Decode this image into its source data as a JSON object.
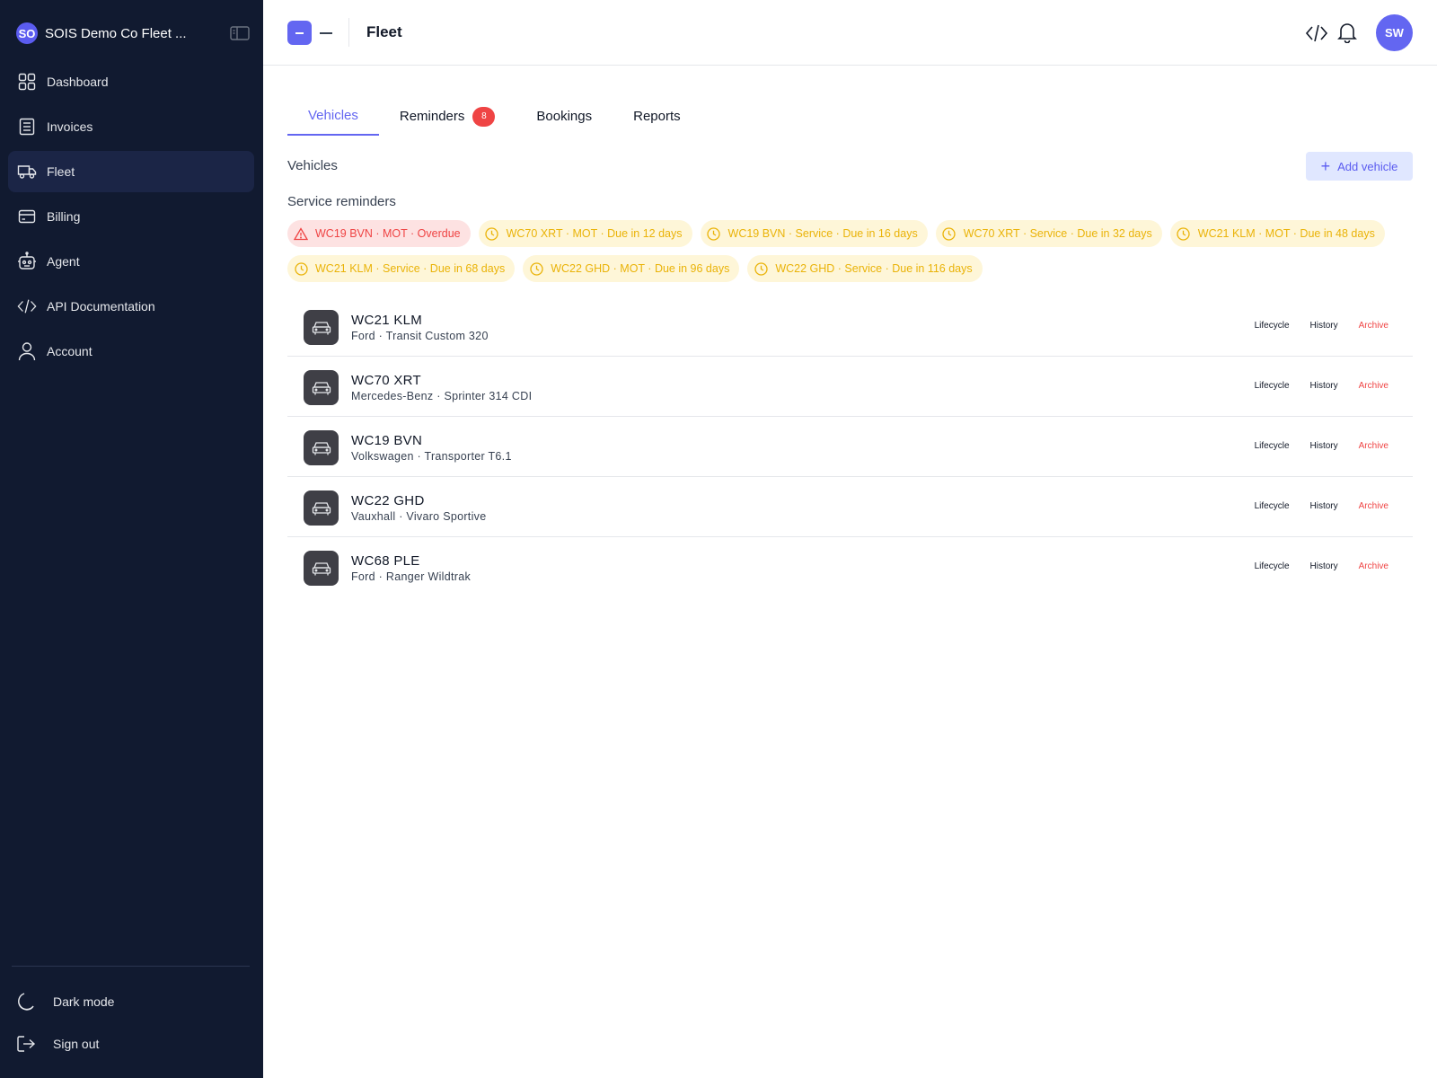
{
  "sidebar": {
    "org_badge": "SO",
    "org_name": "SOIS Demo Co Fleet ...",
    "nav": [
      {
        "label": "Dashboard",
        "icon": "grid-icon"
      },
      {
        "label": "Invoices",
        "icon": "document-icon"
      },
      {
        "label": "Fleet",
        "icon": "truck-icon",
        "active": true
      },
      {
        "label": "Billing",
        "icon": "credit-card-icon"
      },
      {
        "label": "Agent",
        "icon": "robot-icon"
      },
      {
        "label": "API Documentation",
        "icon": "code-icon"
      },
      {
        "label": "Account",
        "icon": "user-icon"
      }
    ],
    "dark_mode_label": "Dark mode",
    "sign_out_label": "Sign out"
  },
  "topbar": {
    "title": "Fleet",
    "avatar_initials": "SW"
  },
  "tabs": [
    {
      "label": "Vehicles",
      "active": true
    },
    {
      "label": "Reminders",
      "badge": "8"
    },
    {
      "label": "Bookings"
    },
    {
      "label": "Reports"
    }
  ],
  "main": {
    "vehicles_heading": "Vehicles",
    "add_vehicle_label": "Add vehicle",
    "reminders_heading": "Service reminders"
  },
  "reminders": [
    {
      "text": "WC19 BVN · MOT · Overdue",
      "status": "overdue"
    },
    {
      "text": "WC70 XRT · MOT · Due in 12 days",
      "status": "due"
    },
    {
      "text": "WC19 BVN · Service · Due in 16 days",
      "status": "due"
    },
    {
      "text": "WC70 XRT · Service · Due in 32 days",
      "status": "due"
    },
    {
      "text": "WC21 KLM · MOT · Due in 48 days",
      "status": "due"
    },
    {
      "text": "WC21 KLM · Service · Due in 68 days",
      "status": "due"
    },
    {
      "text": "WC22 GHD · MOT · Due in 96 days",
      "status": "due"
    },
    {
      "text": "WC22 GHD · Service · Due in 116 days",
      "status": "due"
    }
  ],
  "vehicles": [
    {
      "plate": "WC21 KLM",
      "model": "Ford · Transit Custom 320"
    },
    {
      "plate": "WC70 XRT",
      "model": "Mercedes-Benz · Sprinter 314 CDI"
    },
    {
      "plate": "WC19 BVN",
      "model": "Volkswagen · Transporter T6.1"
    },
    {
      "plate": "WC22 GHD",
      "model": "Vauxhall · Vivaro Sportive"
    },
    {
      "plate": "WC68 PLE",
      "model": "Ford · Ranger Wildtrak"
    }
  ],
  "vehicle_actions": {
    "lifecycle": "Lifecycle",
    "history": "History",
    "archive": "Archive"
  },
  "colors": {
    "sidebar_bg": "#111a30",
    "accent": "#6366f1",
    "overdue": "#ef4444",
    "due": "#eab308"
  }
}
